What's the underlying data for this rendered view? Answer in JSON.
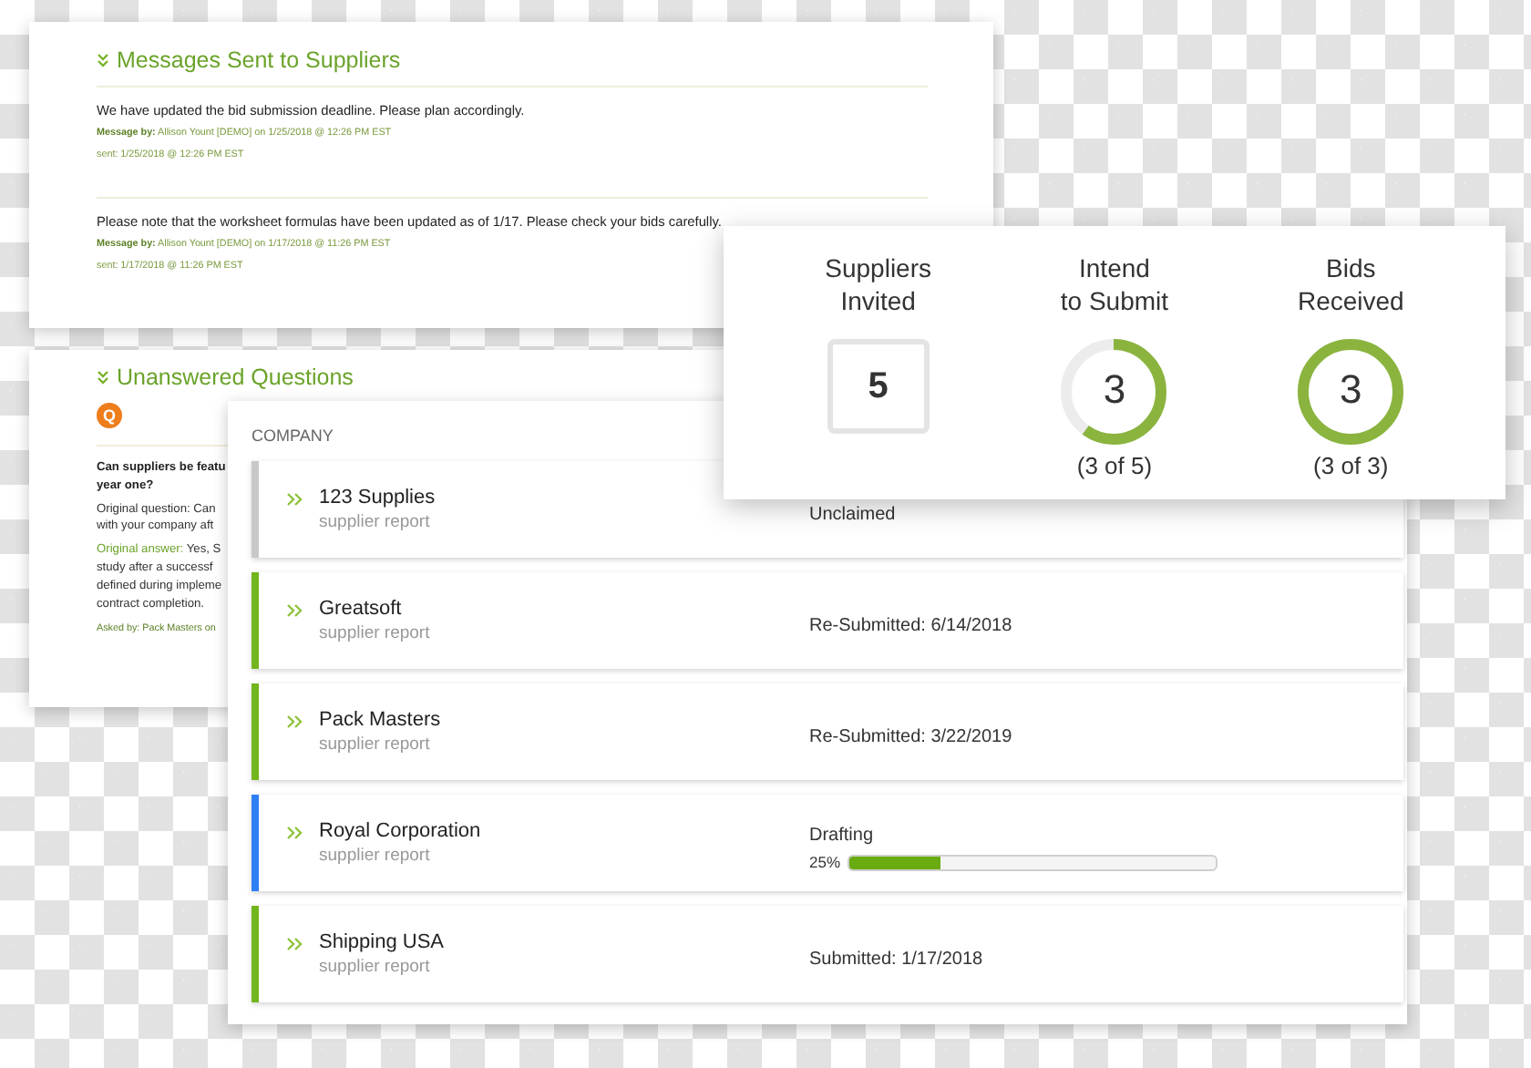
{
  "messages_panel": {
    "title": "Messages Sent to Suppliers",
    "messages": [
      {
        "text": "We have updated the bid submission deadline. Please plan accordingly.",
        "by_label": "Message by:",
        "by": "Allison Yount [DEMO] on 1/25/2018 @ 12:26 PM EST",
        "sent": "sent: 1/25/2018 @ 12:26 PM EST"
      },
      {
        "text": "Please note that the worksheet formulas have been updated as of 1/17. Please check your bids carefully.",
        "by_label": "Message by:",
        "by": "Allison Yount [DEMO] on 1/17/2018 @ 11:26 PM EST",
        "sent": "sent: 1/17/2018 @ 11:26 PM EST"
      }
    ]
  },
  "questions_panel": {
    "title": "Unanswered Questions",
    "badge": "Q",
    "question_lines": [
      "Can suppliers be featu",
      "year one?"
    ],
    "original_question_lines": [
      "Original question: Can",
      "with your company aft"
    ],
    "answer_label": "Original answer:",
    "answer_lines": [
      "Yes, S",
      "study after a successf",
      "defined during impleme",
      "contract completion."
    ],
    "asked_by": "Asked by: Pack Masters on"
  },
  "suppliers_table": {
    "column_header": "COMPANY",
    "rows": [
      {
        "name": "123 Supplies",
        "subtitle": "supplier report",
        "color": "#c8c8c8",
        "kind": "text",
        "status": "Unclaimed"
      },
      {
        "name": "Greatsoft",
        "subtitle": "supplier report",
        "color": "#72b51c",
        "kind": "text",
        "status": "Re-Submitted: 6/14/2018"
      },
      {
        "name": "Pack Masters",
        "subtitle": "supplier report",
        "color": "#72b51c",
        "kind": "text",
        "status": "Re-Submitted: 3/22/2019"
      },
      {
        "name": "Royal Corporation",
        "subtitle": "supplier report",
        "color": "#2f7ff5",
        "kind": "progress",
        "status": "Drafting",
        "percent": "25%",
        "level": 0.25
      },
      {
        "name": "Shipping USA",
        "subtitle": "supplier report",
        "color": "#72b51c",
        "kind": "text",
        "status": "Submitted: 1/17/2018"
      }
    ]
  },
  "stats": [
    {
      "kind": "box",
      "label": [
        "Suppliers",
        "Invited"
      ],
      "value": "5"
    },
    {
      "kind": "ring",
      "label": [
        "Intend",
        "to Submit"
      ],
      "value": "3",
      "level": 0.6,
      "detail": "(3 of 5)"
    },
    {
      "kind": "ring",
      "label": [
        "Bids",
        "Received"
      ],
      "value": "3",
      "level": 1,
      "detail": "(3 of 3)"
    }
  ]
}
